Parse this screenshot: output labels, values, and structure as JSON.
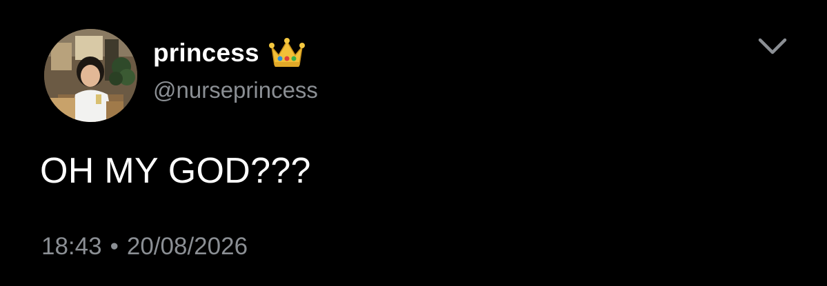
{
  "tweet": {
    "display_name": "princess",
    "display_name_emoji": "crown-emoji",
    "handle": "@nurseprincess",
    "text": "OH MY GOD???",
    "time": "18:43",
    "separator": "•",
    "date": "20/08/2026"
  },
  "icons": {
    "avatar": "profile-photo",
    "menu": "chevron-down-icon"
  },
  "colors": {
    "background": "#000000",
    "primary_text": "#ffffff",
    "secondary_text": "#8b8f94"
  }
}
